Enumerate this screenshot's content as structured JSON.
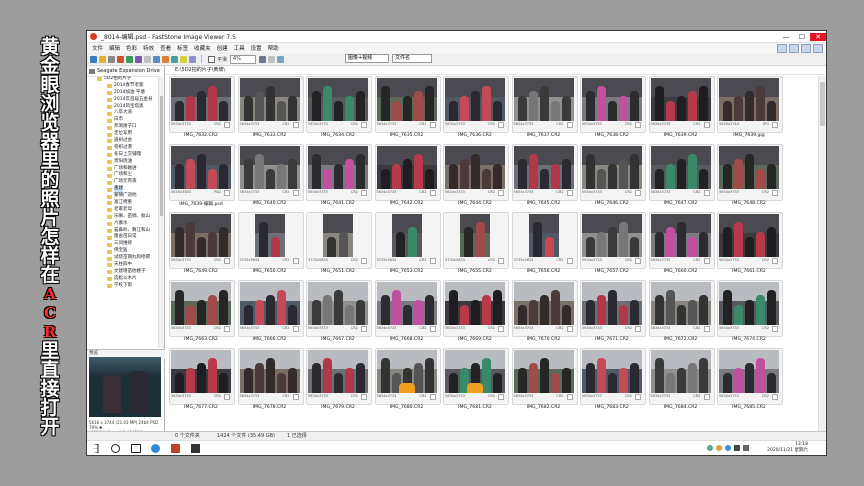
{
  "side_title": [
    "黄",
    "金",
    "眼",
    "浏",
    "览",
    "器",
    "里",
    "的",
    "照",
    "片",
    "怎",
    "样",
    "在",
    "A",
    "C",
    "R",
    "里",
    "直",
    "接",
    "打",
    "开"
  ],
  "window": {
    "title": "_8014-编辑.psd - FastStone Image Viewer 7.5",
    "controls": [
      "—",
      "☐",
      "✕"
    ]
  },
  "menu": [
    "文件",
    "编辑",
    "色彩",
    "特效",
    "查看",
    "标签",
    "收藏夹",
    "创建",
    "工具",
    "设置",
    "帮助"
  ],
  "toolbar": {
    "checkbox_label": "平滑",
    "zoom_value": "4%",
    "filter_value": "图像+视频",
    "sort_value": "文件名"
  },
  "left_panel": {
    "drive_label": "Seagate Expansion Drive",
    "tree_items": [
      "5D2拍的片子",
      "2014春节老家",
      "2014加油 平塘",
      "2014年首届五金县",
      "2014风宝塔奥",
      "八卒大道",
      "白市",
      "邦洞谢子口",
      "定位军用",
      "道树过会",
      "卷织过港",
      "冬日上交铺嘎",
      "贵阳烧油",
      "广场和磁进",
      "广场和尘",
      "广场元宵夜",
      "重建",
      "蒙镇广迎他",
      "富江烤重",
      "老家老母",
      "乐嘛、苗绸、肽山",
      "六寨水",
      "猫鼻岭、舞江和山",
      "隆舍苗日常",
      "三间维修",
      "佛宝猛",
      "试烧苗期丸和修撰",
      "天柱四中",
      "文建增苗他楼子",
      "选松斗木片",
      "学校下雨"
    ],
    "selected_index": 16,
    "preview_label": "预览",
    "preview_info": "5616 x 3744 (21.03 MP)  24bit  PSD  79%  ✱",
    "preview_file": "_8014-编辑.psd [ 1 / 1424 ]"
  },
  "path": "E:\\5D2拍的片子\\黄坡\\",
  "thumbnails": [
    {
      "name": "IMG_7632.CR2",
      "dims": "5634x3733",
      "ext": "CR2"
    },
    {
      "name": "IMG_7633.CR2",
      "dims": "5634x3733",
      "ext": "CR2"
    },
    {
      "name": "IMG_7634.CR2",
      "dims": "5634x3733",
      "ext": "CR2"
    },
    {
      "name": "IMG_7635.CR2",
      "dims": "5634x3733",
      "ext": "CR2"
    },
    {
      "name": "IMG_7636.CR2",
      "dims": "5634x3733",
      "ext": "CR2"
    },
    {
      "name": "IMG_7637.CR2",
      "dims": "5634x3733",
      "ext": "CR2"
    },
    {
      "name": "IMG_7638.CR2",
      "dims": "5634x3733",
      "ext": "CR2"
    },
    {
      "name": "IMG_7639.CR2",
      "dims": "5634x3733",
      "ext": "CR2"
    },
    {
      "name": "IMG_7639.jpg",
      "dims": "5616x3744",
      "ext": "JPG"
    },
    {
      "name": "IMG_7639-编辑.psd",
      "dims": "5616x3584",
      "ext": "PSD"
    },
    {
      "name": "IMG_7640.CR2",
      "dims": "5634x3733",
      "ext": "CR2"
    },
    {
      "name": "IMG_7641.CR2",
      "dims": "5634x3733",
      "ext": "CR2"
    },
    {
      "name": "IMG_7642.CR2",
      "dims": "5634x3733",
      "ext": "CR2"
    },
    {
      "name": "IMG_7644.CR2",
      "dims": "5634x3733",
      "ext": "CR2"
    },
    {
      "name": "IMG_7645.CR2",
      "dims": "5634x3733",
      "ext": "CR2"
    },
    {
      "name": "IMG_7646.CR2",
      "dims": "5634x3733",
      "ext": "CR2"
    },
    {
      "name": "IMG_7647.CR2",
      "dims": "5634x3733",
      "ext": "CR2"
    },
    {
      "name": "IMG_7648.CR2",
      "dims": "5634x3733",
      "ext": "CR2"
    },
    {
      "name": "IMG_7649.CR2",
      "dims": "5634x3733",
      "ext": "CR2"
    },
    {
      "name": "IMG_7650.CR2",
      "dims": "3733x5634",
      "ext": "CR2"
    },
    {
      "name": "IMG_7651.CR2",
      "dims": "3733x5634",
      "ext": "CR2"
    },
    {
      "name": "IMG_7653.CR2",
      "dims": "3733x5634",
      "ext": "CR2"
    },
    {
      "name": "IMG_7655.CR2",
      "dims": "3733x5634",
      "ext": "CR2"
    },
    {
      "name": "IMG_7656.CR2",
      "dims": "3733x5634",
      "ext": "CR2"
    },
    {
      "name": "IMG_7657.CR2",
      "dims": "5634x3733",
      "ext": "CR2"
    },
    {
      "name": "IMG_7660.CR2",
      "dims": "5634x3733",
      "ext": "CR2"
    },
    {
      "name": "IMG_7661.CR2",
      "dims": "5634x3733",
      "ext": "CR2"
    },
    {
      "name": "IMG_7663.CR2",
      "dims": "5634x3733",
      "ext": "CR2"
    },
    {
      "name": "IMG_7666.CR2",
      "dims": "5634x3733",
      "ext": "CR2"
    },
    {
      "name": "IMG_7667.CR2",
      "dims": "5634x3733",
      "ext": "CR2"
    },
    {
      "name": "IMG_7668.CR2",
      "dims": "5634x3733",
      "ext": "CR2"
    },
    {
      "name": "IMG_7669.CR2",
      "dims": "5634x3733",
      "ext": "CR2"
    },
    {
      "name": "IMG_7670.CR2",
      "dims": "5634x3733",
      "ext": "CR2"
    },
    {
      "name": "IMG_7671.CR2",
      "dims": "5634x3733",
      "ext": "CR2"
    },
    {
      "name": "IMG_7672.CR2",
      "dims": "5634x3733",
      "ext": "CR2"
    },
    {
      "name": "IMG_7674.CR2",
      "dims": "5634x3733",
      "ext": "CR2"
    },
    {
      "name": "IMG_7677.CR2",
      "dims": "5634x3733",
      "ext": "CR2"
    },
    {
      "name": "IMG_7678.CR2",
      "dims": "5634x3733",
      "ext": "CR2"
    },
    {
      "name": "IMG_7679.CR2",
      "dims": "5634x3733",
      "ext": "CR2"
    },
    {
      "name": "IMG_7680.CR2",
      "dims": "5634x3733",
      "ext": "CR2"
    },
    {
      "name": "IMG_7681.CR2",
      "dims": "5634x3733",
      "ext": "CR2"
    },
    {
      "name": "IMG_7682.CR2",
      "dims": "5634x3733",
      "ext": "CR2"
    },
    {
      "name": "IMG_7683.CR2",
      "dims": "5634x3733",
      "ext": "CR2"
    },
    {
      "name": "IMG_7684.CR2",
      "dims": "5634x3733",
      "ext": "CR2"
    },
    {
      "name": "IMG_7685.CR2",
      "dims": "5634x3733",
      "ext": "CR2"
    }
  ],
  "status": {
    "folders": "0 个文件夹",
    "files": "1424 个文件 (35.49 GB)",
    "selected": "1 已选择"
  },
  "taskbar": {
    "time": "13:18",
    "date": "2020/11/21 星期六"
  },
  "colors": {
    "accent_red": "#ff2a2a",
    "selection": "#cce4f7",
    "close": "#e81123"
  }
}
